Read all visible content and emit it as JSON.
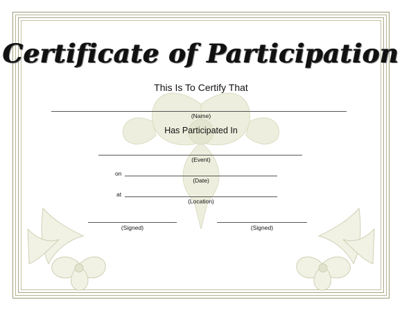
{
  "certificate": {
    "title": "Certificate of Participation",
    "subtitle": "This Is To Certify That",
    "name_caption": "(Name)",
    "participated_text": "Has Participated In",
    "event_caption": "(Event)",
    "on_label": "on",
    "date_caption": "(Date)",
    "at_label": "at",
    "location_caption": "(Location)",
    "signed_left_caption": "(Signed)",
    "signed_right_caption": "(Signed)"
  },
  "colors": {
    "border": "#9c9b78",
    "watermark": "#e9ead6"
  },
  "icons": {
    "watermark": "floral-watermark",
    "corner_left": "flower-corner-left",
    "corner_right": "flower-corner-right"
  }
}
